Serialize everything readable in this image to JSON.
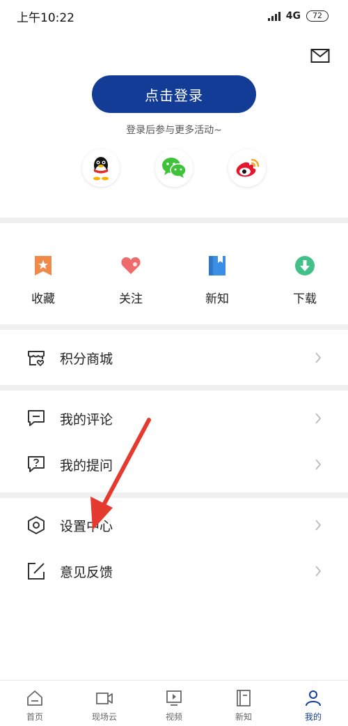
{
  "status": {
    "time": "上午10:22",
    "network": "4G",
    "battery": "72"
  },
  "login": {
    "button_label": "点击登录",
    "hint": "登录后参与更多活动~"
  },
  "social": [
    "qq-icon",
    "wechat-icon",
    "weibo-icon"
  ],
  "quick_actions": [
    {
      "label": "收藏",
      "icon": "bookmark-star-icon",
      "color": "#f08a4b"
    },
    {
      "label": "关注",
      "icon": "heart-icon",
      "color": "#ef6b6b"
    },
    {
      "label": "新知",
      "icon": "book-icon",
      "color": "#3a8ee6"
    },
    {
      "label": "下载",
      "icon": "download-icon",
      "color": "#43c08a"
    }
  ],
  "menu": {
    "points_mall": "积分商城",
    "my_comments": "我的评论",
    "my_questions": "我的提问",
    "settings_center": "设置中心",
    "feedback": "意见反馈"
  },
  "tabs": [
    {
      "label": "首页",
      "icon": "home-icon"
    },
    {
      "label": "现场云",
      "icon": "video-camera-icon"
    },
    {
      "label": "视频",
      "icon": "play-screen-icon"
    },
    {
      "label": "新知",
      "icon": "book-icon"
    },
    {
      "label": "我的",
      "icon": "user-icon",
      "active": true
    }
  ],
  "colors": {
    "accent": "#123c96",
    "annotation": "#e53a2f"
  }
}
